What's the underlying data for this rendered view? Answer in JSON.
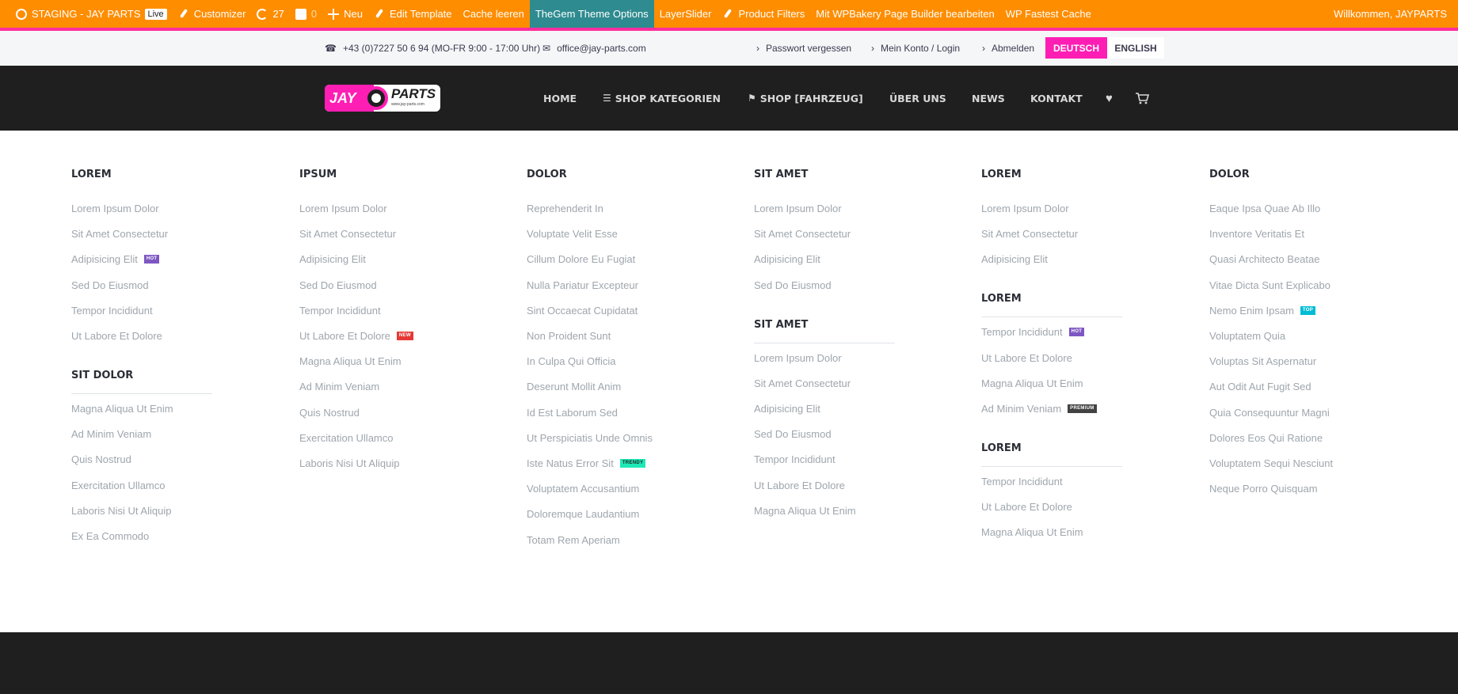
{
  "adminbar": {
    "site_name": "STAGING - JAY PARTS",
    "live_badge": "Live",
    "customizer": "Customizer",
    "updates_count": "27",
    "comments_count": "0",
    "new_label": "Neu",
    "edit_template": "Edit Template",
    "cache_clear": "Cache leeren",
    "theme_options": "TheGem Theme Options",
    "layerslider": "LayerSlider",
    "product_filters": "Product Filters",
    "wpbakery": "Mit WPBakery Page Builder bearbeiten",
    "wp_fastest_cache": "WP Fastest Cache",
    "welcome": "Willkommen, JAYPARTS"
  },
  "topbar": {
    "phone": "+43 (0)7227 50 6 94 (MO-FR 9:00 - 17:00 Uhr)",
    "email": "office@jay-parts.com",
    "links": [
      "Passwort vergessen",
      "Mein Konto / Login",
      "Abmelden"
    ],
    "lang_active": "DEUTSCH",
    "lang_other": "ENGLISH"
  },
  "logo": {
    "text_left": "JAY",
    "text_right": "PARTS",
    "url_text": "www.jay-parts.com"
  },
  "nav": {
    "items": [
      "HOME",
      "SHOP KATEGORIEN",
      "SHOP [FAHRZEUG]",
      "ÜBER UNS",
      "NEWS",
      "KONTAKT"
    ]
  },
  "icons": {
    "phone": "phone-icon",
    "mail": "mail-icon",
    "wishlist": "heart-icon",
    "cart": "cart-icon"
  },
  "colors": {
    "admin_bar": "#ff8d00",
    "accent_pink": "#ff1eb4",
    "header_dark": "#1f1f1f",
    "theme_options_bg": "#2e8b8f",
    "badge_hot": "#7e57c2",
    "badge_new": "#e53935",
    "badge_trendy": "#1de9b6",
    "badge_top": "#00bcd4",
    "badge_premium": "#424242"
  },
  "mega": {
    "columns": [
      {
        "sections": [
          {
            "title": "LOREM",
            "items": [
              {
                "label": "Lorem Ipsum Dolor"
              },
              {
                "label": "Sit Amet Consectetur"
              },
              {
                "label": "Adipisicing Elit",
                "badge": "HOT"
              },
              {
                "label": "Sed Do Eiusmod"
              },
              {
                "label": "Tempor Incididunt"
              },
              {
                "label": "Ut Labore Et Dolore"
              }
            ]
          },
          {
            "title": "SIT DOLOR",
            "items": [
              {
                "label": "Magna Aliqua Ut Enim"
              },
              {
                "label": "Ad Minim Veniam"
              },
              {
                "label": "Quis Nostrud"
              },
              {
                "label": "Exercitation Ullamco"
              },
              {
                "label": "Laboris Nisi Ut Aliquip"
              },
              {
                "label": "Ex Ea Commodo"
              }
            ]
          }
        ]
      },
      {
        "sections": [
          {
            "title": "IPSUM",
            "items": [
              {
                "label": "Lorem Ipsum Dolor"
              },
              {
                "label": "Sit Amet Consectetur"
              },
              {
                "label": "Adipisicing Elit"
              },
              {
                "label": "Sed Do Eiusmod"
              },
              {
                "label": "Tempor Incididunt"
              },
              {
                "label": "Ut Labore Et Dolore",
                "badge": "NEW"
              },
              {
                "label": "Magna Aliqua Ut Enim"
              },
              {
                "label": "Ad Minim Veniam"
              },
              {
                "label": "Quis Nostrud"
              },
              {
                "label": "Exercitation Ullamco"
              },
              {
                "label": "Laboris Nisi Ut Aliquip"
              }
            ]
          }
        ]
      },
      {
        "sections": [
          {
            "title": "DOLOR",
            "items": [
              {
                "label": "Reprehenderit In"
              },
              {
                "label": "Voluptate Velit Esse"
              },
              {
                "label": "Cillum Dolore Eu Fugiat"
              },
              {
                "label": "Nulla Pariatur Excepteur"
              },
              {
                "label": "Sint Occaecat Cupidatat"
              },
              {
                "label": "Non Proident Sunt"
              },
              {
                "label": "In Culpa Qui Officia"
              },
              {
                "label": "Deserunt Mollit Anim"
              },
              {
                "label": "Id Est Laborum Sed"
              },
              {
                "label": "Ut Perspiciatis Unde Omnis"
              },
              {
                "label": "Iste Natus Error Sit",
                "badge": "TRENDY"
              },
              {
                "label": "Voluptatem Accusantium"
              },
              {
                "label": "Doloremque Laudantium"
              },
              {
                "label": "Totam Rem Aperiam"
              }
            ]
          }
        ]
      },
      {
        "sections": [
          {
            "title": "SIT AMET",
            "items": [
              {
                "label": "Lorem Ipsum Dolor"
              },
              {
                "label": "Sit Amet Consectetur"
              },
              {
                "label": "Adipisicing Elit"
              },
              {
                "label": "Sed Do Eiusmod"
              }
            ]
          },
          {
            "title": "SIT AMET",
            "items": [
              {
                "label": "Lorem Ipsum Dolor"
              },
              {
                "label": "Sit Amet Consectetur"
              },
              {
                "label": "Adipisicing Elit"
              },
              {
                "label": "Sed Do Eiusmod"
              },
              {
                "label": "Tempor Incididunt"
              },
              {
                "label": "Ut Labore Et Dolore"
              },
              {
                "label": "Magna Aliqua Ut Enim"
              }
            ]
          }
        ]
      },
      {
        "sections": [
          {
            "title": "LOREM",
            "items": [
              {
                "label": "Lorem Ipsum Dolor"
              },
              {
                "label": "Sit Amet Consectetur"
              },
              {
                "label": "Adipisicing Elit"
              }
            ]
          },
          {
            "title": "LOREM",
            "items": [
              {
                "label": "Tempor Incididunt",
                "badge": "HOT"
              },
              {
                "label": "Ut Labore Et Dolore"
              },
              {
                "label": "Magna Aliqua Ut Enim"
              },
              {
                "label": "Ad Minim Veniam",
                "badge": "PREMIUM"
              }
            ]
          },
          {
            "title": "LOREM",
            "items": [
              {
                "label": "Tempor Incididunt"
              },
              {
                "label": "Ut Labore Et Dolore"
              },
              {
                "label": "Magna Aliqua Ut Enim"
              }
            ]
          }
        ]
      },
      {
        "sections": [
          {
            "title": "DOLOR",
            "items": [
              {
                "label": "Eaque Ipsa Quae Ab Illo"
              },
              {
                "label": "Inventore Veritatis Et"
              },
              {
                "label": "Quasi Architecto Beatae"
              },
              {
                "label": "Vitae Dicta Sunt Explicabo"
              },
              {
                "label": "Nemo Enim Ipsam",
                "badge": "TOP"
              },
              {
                "label": "Voluptatem Quia"
              },
              {
                "label": "Voluptas Sit Aspernatur"
              },
              {
                "label": "Aut Odit Aut Fugit Sed"
              },
              {
                "label": "Quia Consequuntur Magni"
              },
              {
                "label": "Dolores Eos Qui Ratione"
              },
              {
                "label": "Voluptatem Sequi Nesciunt"
              },
              {
                "label": "Neque Porro Quisquam"
              }
            ]
          }
        ]
      }
    ]
  }
}
